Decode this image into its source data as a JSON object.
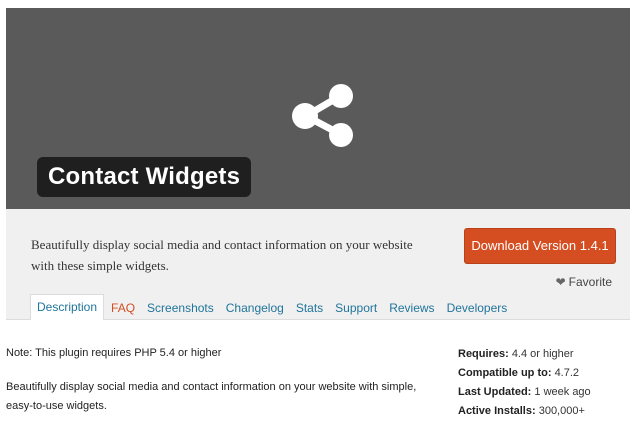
{
  "banner": {
    "title": "Contact Widgets",
    "bg_color": "#5a5a5a",
    "icon": "share-icon"
  },
  "summary": {
    "description": "Beautifully display social media and contact information on your website with these simple widgets.",
    "download_label": "Download Version 1.4.1",
    "favorite_label": "Favorite",
    "accent_color": "#d54e21"
  },
  "tabs": [
    {
      "label": "Description"
    },
    {
      "label": "FAQ"
    },
    {
      "label": "Screenshots"
    },
    {
      "label": "Changelog"
    },
    {
      "label": "Stats"
    },
    {
      "label": "Support"
    },
    {
      "label": "Reviews"
    },
    {
      "label": "Developers"
    }
  ],
  "content": {
    "note": "Note: This plugin requires PHP 5.4 or higher",
    "description": "Beautifully display social media and contact information on your website with simple, easy-to-use widgets."
  },
  "meta": {
    "requires_label": "Requires:",
    "requires_value": "4.4 or higher",
    "compatible_label": "Compatible up to:",
    "compatible_value": "4.7.2",
    "updated_label": "Last Updated:",
    "updated_value": "1 week ago",
    "installs_label": "Active Installs:",
    "installs_value": "300,000+"
  }
}
